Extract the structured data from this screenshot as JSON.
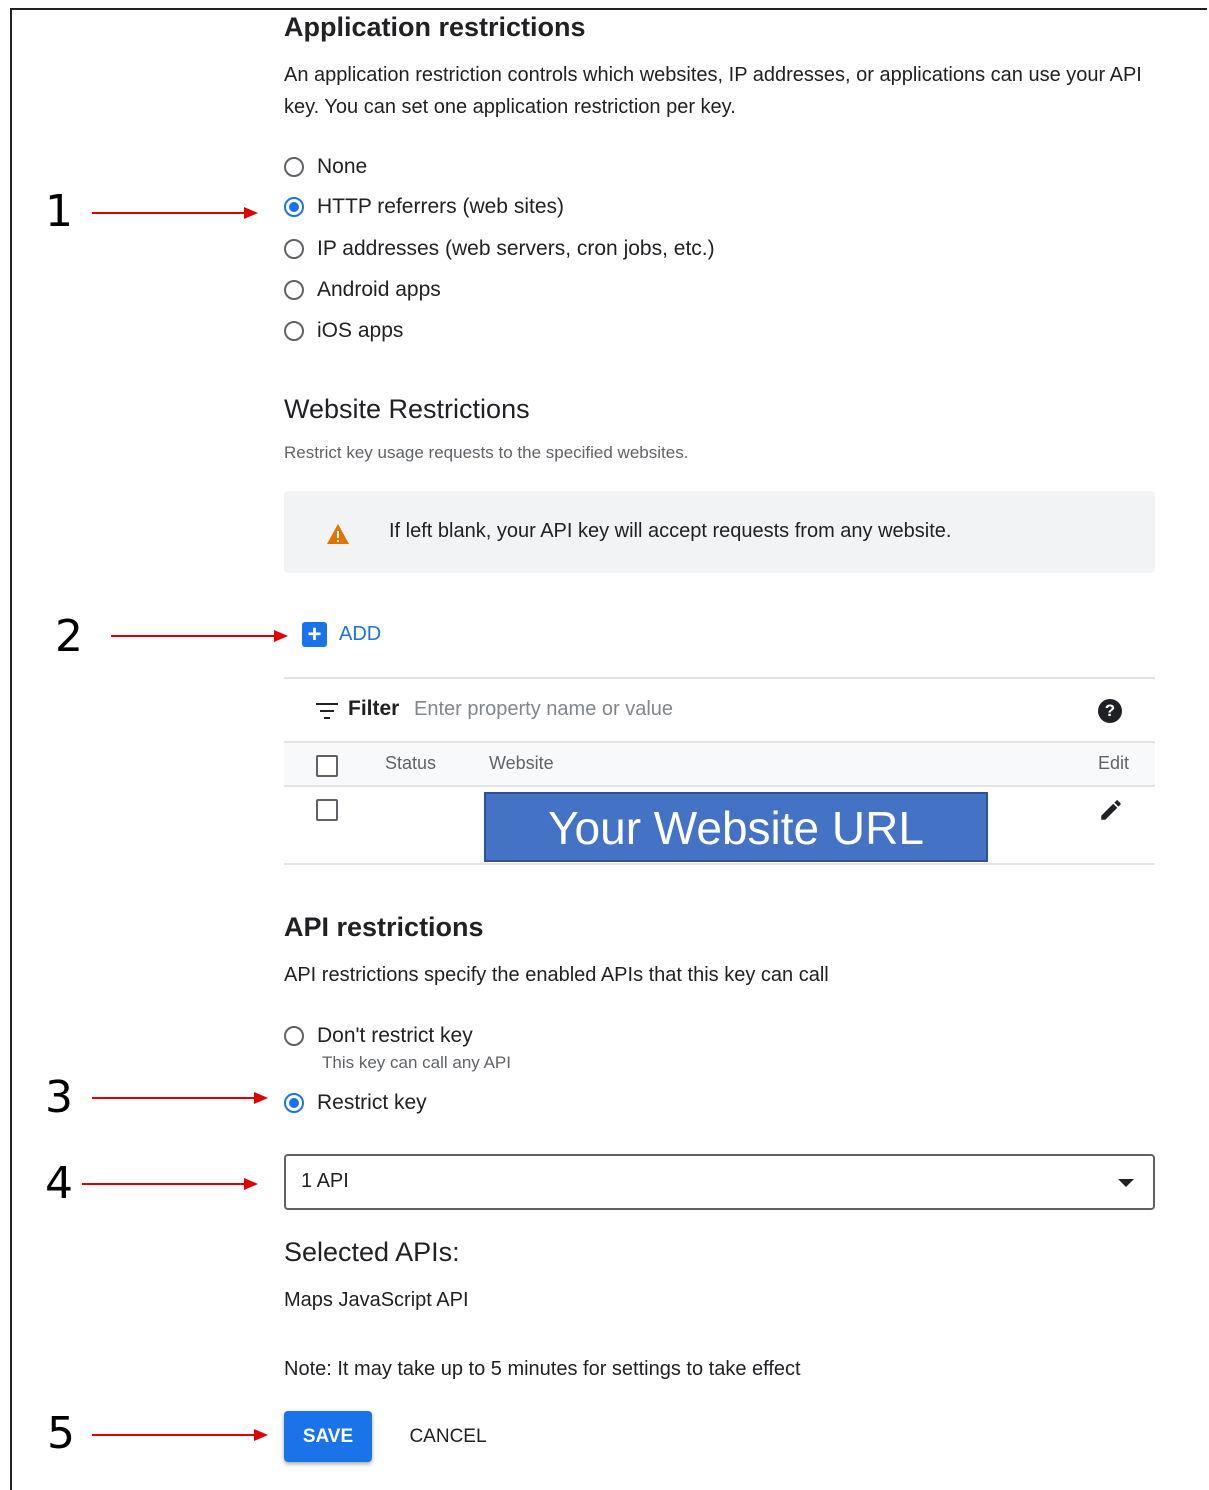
{
  "application_restrictions": {
    "title": "Application restrictions",
    "description": "An application restriction controls which websites, IP addresses, or applications can use your API key. You can set one application restriction per key.",
    "options": [
      {
        "label": "None",
        "selected": false
      },
      {
        "label": "HTTP referrers (web sites)",
        "selected": true
      },
      {
        "label": "IP addresses (web servers, cron jobs, etc.)",
        "selected": false
      },
      {
        "label": "Android apps",
        "selected": false
      },
      {
        "label": "iOS apps",
        "selected": false
      }
    ]
  },
  "website_restrictions": {
    "title": "Website Restrictions",
    "subtitle": "Restrict key usage requests to the specified websites.",
    "warning": "If left blank, your API key will accept requests from any website.",
    "add_label": "ADD",
    "filter": {
      "label": "Filter",
      "placeholder": "Enter property name or value",
      "help_glyph": "?"
    },
    "columns": {
      "status": "Status",
      "website": "Website",
      "edit": "Edit"
    },
    "rows": [
      {
        "website": "Your Website URL"
      }
    ]
  },
  "api_restrictions": {
    "title": "API restrictions",
    "description": "API restrictions specify the enabled APIs that this key can call",
    "options": [
      {
        "label": "Don't restrict key",
        "sublabel": "This key can call any API",
        "selected": false
      },
      {
        "label": "Restrict key",
        "selected": true
      }
    ],
    "select_value": "1 API",
    "selected_title": "Selected APIs:",
    "selected_apis": [
      "Maps JavaScript API"
    ],
    "note": "Note: It may take up to 5 minutes for settings to take effect"
  },
  "actions": {
    "save": "SAVE",
    "cancel": "CANCEL"
  },
  "annotations": [
    "1",
    "2",
    "3",
    "4",
    "5"
  ],
  "colors": {
    "accent": "#1a73e8",
    "warning": "#e37400",
    "arrow": "#e00000",
    "url_box": "#4472c4"
  }
}
